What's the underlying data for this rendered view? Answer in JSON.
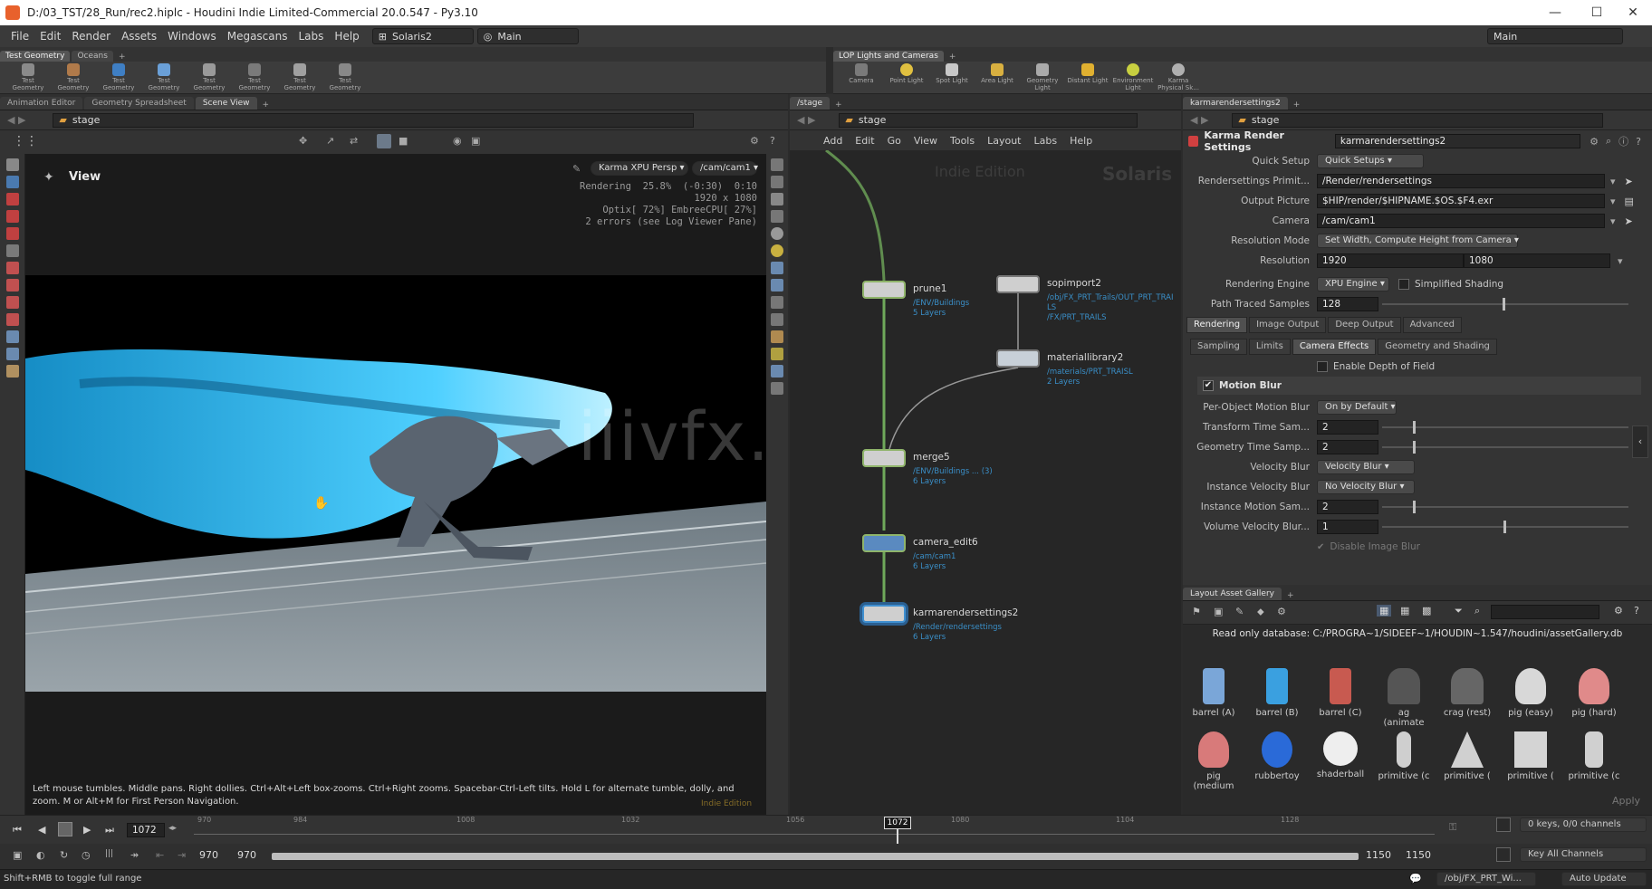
{
  "window": {
    "title": "D:/03_TST/28_Run/rec2.hiplc - Houdini Indie Limited-Commercial 20.0.547 - Py3.10",
    "minimize": "—",
    "maximize": "☐",
    "close": "✕"
  },
  "menubar": {
    "items": [
      "File",
      "Edit",
      "Render",
      "Assets",
      "Windows",
      "Megascans",
      "Labs",
      "Help"
    ],
    "desktop": "Solaris2",
    "main_left": "Main",
    "main_right": "Main"
  },
  "shelf_left": {
    "tabs": [
      "Test Geometry",
      "Oceans"
    ],
    "tools": [
      "Test Geometry",
      "Test Geometry",
      "Test Geometry",
      "Test Geometry",
      "Test Geometry",
      "Test Geometry",
      "Test Geometry",
      "Test Geometry"
    ]
  },
  "shelf_right": {
    "tab": "LOP Lights and Cameras",
    "tools": [
      "Camera",
      "Point Light",
      "Spot Light",
      "Area Light",
      "Geometry Light",
      "Distant Light",
      "Environment Light",
      "Karma Physical Sk..."
    ]
  },
  "viewer": {
    "tabs": [
      "Animation Editor",
      "Geometry Spreadsheet",
      "Scene View"
    ],
    "path": "stage",
    "view_label": "View",
    "renderer_btn": "Karma XPU Persp",
    "camera_btn": "/cam/cam1",
    "hud_lines": "Rendering  25.8%  (-0:30)  0:10\n1920 x 1080\nOptix[ 72%] EmbreeCPU[ 27%]\n2 errors (see Log Viewer Pane)",
    "watermark": "iiivfx.com",
    "status": "Left mouse tumbles. Middle pans. Right dollies. Ctrl+Alt+Left box-zooms. Ctrl+Right zooms. Spacebar-Ctrl-Left tilts. Hold L for alternate tumble, dolly, and zoom. M or Alt+M for First Person Navigation.",
    "indie_tag": "Indie Edition"
  },
  "network": {
    "tab": "/stage",
    "path": "stage",
    "menu": [
      "Add",
      "Edit",
      "Go",
      "View",
      "Tools",
      "Layout",
      "Labs",
      "Help"
    ],
    "indie_watermark": "Indie Edition",
    "context_watermark": "Solaris",
    "nodes": [
      {
        "name": "prune1",
        "sub": "/ENV/Buildings\n5 Layers"
      },
      {
        "name": "sopimport2",
        "sub": "/obj/FX_PRT_Trails/OUT_PRT_TRAI\nLS\n/FX/PRT_TRAILS"
      },
      {
        "name": "materiallibrary2",
        "sub": "/materials/PRT_TRAISL\n2 Layers"
      },
      {
        "name": "merge5",
        "sub": "/ENV/Buildings ... (3)\n6 Layers"
      },
      {
        "name": "camera_edit6",
        "sub": "/cam/cam1\n6 Layers"
      },
      {
        "name": "karmarendersettings2",
        "sub": "/Render/rendersettings\n6 Layers"
      }
    ]
  },
  "params": {
    "tab": "karmarendersettings2",
    "path": "stage",
    "node_type": "Karma Render Settings",
    "node_name": "karmarendersettings2",
    "quick_setup_label": "Quick Setup",
    "quick_setup_value": "Quick Setups",
    "rs_prim_label": "Rendersettings Primit...",
    "rs_prim_value": "/Render/rendersettings",
    "output_label": "Output Picture",
    "output_value": "$HIP/render/$HIPNAME.$OS.$F4.exr",
    "camera_label": "Camera",
    "camera_value": "/cam/cam1",
    "resmode_label": "Resolution Mode",
    "resmode_value": "Set Width, Compute Height from Camera",
    "res_label": "Resolution",
    "res_w": "1920",
    "res_h": "1080",
    "engine_label": "Rendering Engine",
    "engine_value": "XPU Engine",
    "simplified": "Simplified Shading",
    "pts_label": "Path Traced Samples",
    "pts_value": "128",
    "tabs1": [
      "Rendering",
      "Image Output",
      "Deep Output",
      "Advanced"
    ],
    "tabs2": [
      "Sampling",
      "Limits",
      "Camera Effects",
      "Geometry and Shading"
    ],
    "dof": "Enable Depth of Field",
    "motion_blur": "Motion Blur",
    "pomb_label": "Per-Object Motion Blur",
    "pomb_value": "On by Default",
    "tts_label": "Transform Time Sam...",
    "tts_value": "2",
    "gts_label": "Geometry Time Samp...",
    "gts_value": "2",
    "vb_label": "Velocity Blur",
    "vb_value": "Velocity Blur",
    "ivb_label": "Instance Velocity Blur",
    "ivb_value": "No Velocity Blur",
    "ims_label": "Instance Motion Sam...",
    "ims_value": "2",
    "vvb_label": "Volume Velocity Blur...",
    "vvb_value": "1",
    "disable_image_blur": "Disable Image Blur"
  },
  "gallery": {
    "tab": "Layout Asset Gallery",
    "db": "Read only database: C:/PROGRA~1/SIDEEF~1/HOUDIN~1.547/houdini/assetGallery.db",
    "assets_row1": [
      "barrel (A)",
      "barrel (B)",
      "barrel (C)",
      "ag (animate",
      "crag (rest)",
      "pig (easy)",
      "pig (hard)"
    ],
    "assets_row2": [
      "pig (medium",
      "rubbertoy",
      "shaderball",
      "primitive (c",
      "primitive (",
      "primitive (",
      "primitive (c"
    ],
    "apply": "Apply"
  },
  "timeline": {
    "ticks": [
      "970",
      "984",
      "1008",
      "1032",
      "1056",
      "1080",
      "1104",
      "1128"
    ],
    "current_frame": "1072",
    "frame_marker": "1072",
    "range_start": "970",
    "range_start2": "970",
    "range_end": "1150",
    "range_end2": "1150",
    "keys": "0 keys, 0/0 channels",
    "key_all": "Key All Channels"
  },
  "statusbar": {
    "hint": "Shift+RMB to toggle full range",
    "path": "/obj/FX_PRT_Wi...",
    "auto_update": "Auto Update"
  }
}
